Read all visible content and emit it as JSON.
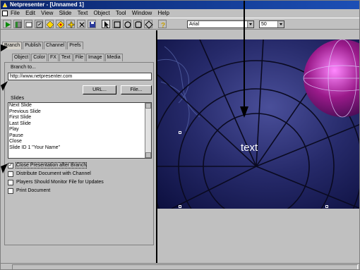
{
  "window": {
    "title": "Netpresenter - [Unnamed 1]"
  },
  "menu": [
    "File",
    "Edit",
    "View",
    "Slide",
    "Text",
    "Object",
    "Tool",
    "Window",
    "Help"
  ],
  "toolbar": {
    "icons": [
      "play-icon",
      "slide-icon",
      "window-icon",
      "link-icon",
      "diamond-icon",
      "shape-icon",
      "add-icon",
      "delete-icon",
      "save-icon",
      "pointer-icon",
      "rectangle-icon",
      "ellipse-icon",
      "rounded-rect-icon",
      "diamond-shape-icon",
      "help-icon"
    ],
    "font": "Arial",
    "size": "50"
  },
  "panel": {
    "tabs_top": [
      "Branch",
      "Publish",
      "Channel",
      "Prefs"
    ],
    "tabs_second": [
      "Object",
      "Color",
      "FX",
      "Text",
      "File",
      "Image",
      "Media"
    ],
    "branch_to_label": "Branch to...",
    "branch_url": "http://www.netpresenter.com",
    "url_button": "URL...",
    "file_button": "File...",
    "slides_label": "Slides",
    "slides": [
      "Next Slide",
      "Previous Slide",
      "First Slide",
      "Last Slide",
      "Play",
      "Pause",
      "Close",
      "Slide ID 1  \"Your Name\""
    ],
    "options": [
      {
        "label": "Close Presentation after Branch",
        "checked": true
      },
      {
        "label": "Distribute Document with Channel",
        "checked": false
      },
      {
        "label": "Players Should Monitor File for Updates",
        "checked": false
      },
      {
        "label": "Print Document",
        "checked": false
      }
    ]
  },
  "slide": {
    "text": "text"
  },
  "status": {
    "text": ""
  },
  "colors": {
    "titlebar": "#0a246a",
    "slide_bg": "#1a1f5a",
    "selection": "#ffffff"
  }
}
